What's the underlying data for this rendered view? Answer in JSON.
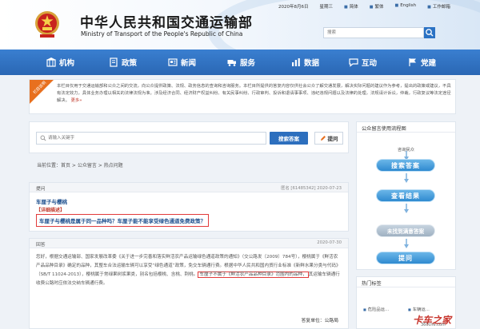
{
  "header": {
    "title_cn": "中华人民共和国交通运输部",
    "title_en": "Ministry of Transport of the People's Republic of China",
    "date": "2020年8月6日",
    "weekday": "星期三",
    "links": [
      "简体",
      "繁体",
      "English",
      "工作邮箱"
    ]
  },
  "search": {
    "placeholder": "搜索"
  },
  "nav": {
    "items": [
      "机构",
      "政策",
      "新闻",
      "服务",
      "数据",
      "互动",
      "党建"
    ]
  },
  "notice": {
    "tag": "栏目说明",
    "text": "本栏目仅用于交通运输部和公众之间的交流，向公众提供政策、法规、政务信息的查询和咨询服务。本栏目所提供的答复内容仅供社会公众了解交通发展，解决实际问题的建议作为参考，提出的政策或建议，不具有法定效力，具体业务办理以相关的法律法规为准。涉及经济合同、经济财产权益纠纷、有关民事纠纷、行政审判、投诉和退请事事项、违纪违规问题以及法律的处理，法规请计诉讼，仲裁，行政复议等法定途径解决。",
    "more": "更多»"
  },
  "left": {
    "keyword_placeholder": "请输入关键字",
    "search_button": "搜索答案",
    "ask_button": "提问",
    "breadcrumb": "当前位置：首页 > 公众留言 > 热点问题"
  },
  "question": {
    "label": "提问",
    "meta": "匿名 [61485342]  2020-07-23",
    "title": "车厘子与樱桃",
    "detail": "【详细描述】",
    "text": "车厘子与樱桃是属于同一品种吗？车厘子能不能享受绿色通道免费政策？"
  },
  "answer": {
    "label": "回答",
    "date": "2020-07-30",
    "text_part1": "您好，根据交通运输部、国家发展改革委《关于进一步完善和落实鲜活农产品运输绿色通道政策的通知》（交公路发〔2009〕784号），樱桃属于《鲜活农产品品种目录》确定的品种，其整车合法运输车辆可以享受“绿色通道”政策，免交车辆通行费。根据中华人民共和国内贸行业标准《新鲜水果分类与代码》（SB/T 11024-2013），樱桃属于常绿果树浆果类，别名包括樱桃、含桃、荆桃。",
    "text_highlight": "车厘子不属于《鲜活农产品品种目录》范围内的品种，",
    "text_part2": "其运输车辆通行收费公路时应依法交纳车辆通行费。",
    "signature": "答复单位：公路局"
  },
  "flow": {
    "title": "公众留言使用流程图",
    "caption": "咨询民众",
    "steps": [
      "搜索答案",
      "查看结果",
      "未找到满意答案",
      "提问"
    ]
  },
  "tags": {
    "title": "热门标签",
    "items": [
      "危险品运…",
      "车辆运…"
    ]
  },
  "watermark": {
    "text": "卡车之家",
    "sub": "360che.com"
  },
  "colors": {
    "nav": "#2f72c2",
    "highlight_border": "#e23b3b",
    "link_blue": "#1d4f8e"
  }
}
